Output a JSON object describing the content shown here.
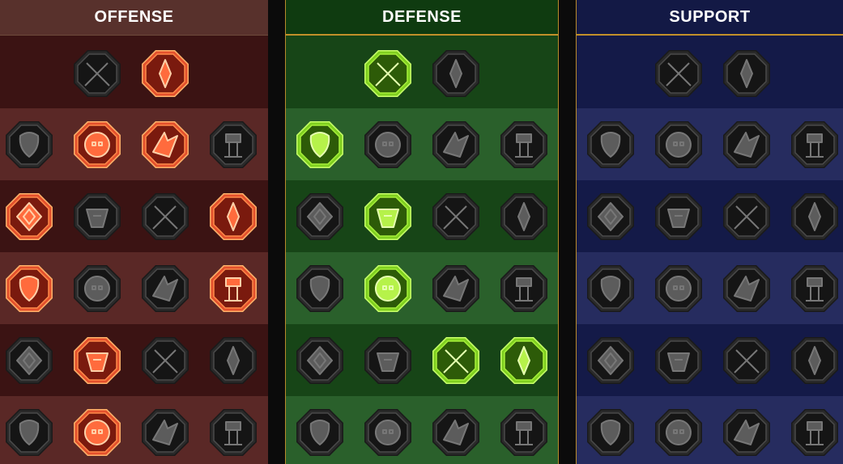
{
  "trees": [
    {
      "id": "offense",
      "title": "OFFENSE",
      "rows": [
        [
          {
            "icon": "crossed-swords-icon",
            "state": "inactive"
          },
          {
            "icon": "flaming-dagger-icon",
            "state": "active"
          }
        ],
        [
          {
            "icon": "horned-demon-icon",
            "state": "inactive"
          },
          {
            "icon": "slashing-blade-icon",
            "state": "active"
          },
          {
            "icon": "shield-breaker-icon",
            "state": "active"
          },
          {
            "icon": "thorned-heart-icon",
            "state": "inactive"
          }
        ],
        [
          {
            "icon": "pierced-warrior-icon",
            "state": "active"
          },
          {
            "icon": "fanged-maw-icon",
            "state": "inactive"
          },
          {
            "icon": "skull-slash-icon",
            "state": "inactive"
          },
          {
            "icon": "knife-strike-icon",
            "state": "active"
          }
        ],
        [
          {
            "icon": "bleeding-heart-icon",
            "state": "active"
          },
          {
            "icon": "iron-fist-icon",
            "state": "inactive"
          },
          {
            "icon": "battle-axe-icon",
            "state": "inactive"
          },
          {
            "icon": "lightning-chain-icon",
            "state": "active"
          }
        ],
        [
          {
            "icon": "impaled-target-icon",
            "state": "inactive"
          },
          {
            "icon": "triple-skull-icon",
            "state": "active"
          },
          {
            "icon": "dagger-aura-icon",
            "state": "inactive"
          },
          {
            "icon": "enraged-brute-icon",
            "state": "inactive"
          }
        ],
        [
          {
            "icon": "sword-sparkle-icon",
            "state": "inactive"
          },
          {
            "icon": "burning-helm-icon",
            "state": "active"
          },
          {
            "icon": "winged-beast-icon",
            "state": "inactive"
          },
          {
            "icon": "death-aura-icon",
            "state": "inactive"
          }
        ]
      ]
    },
    {
      "id": "defense",
      "title": "DEFENSE",
      "rows": [
        [
          {
            "icon": "armor-plates-icon",
            "state": "active"
          },
          {
            "icon": "raised-fist-icon",
            "state": "inactive"
          }
        ],
        [
          {
            "icon": "chevron-shield-icon",
            "state": "active"
          },
          {
            "icon": "stone-heart-icon",
            "state": "inactive"
          },
          {
            "icon": "armored-titan-icon",
            "state": "inactive"
          },
          {
            "icon": "deflect-blade-icon",
            "state": "inactive"
          }
        ],
        [
          {
            "icon": "evasive-figure-icon",
            "state": "inactive"
          },
          {
            "icon": "knight-shield-icon",
            "state": "active"
          },
          {
            "icon": "heart-icon",
            "state": "inactive"
          },
          {
            "icon": "protective-aura-icon",
            "state": "inactive"
          }
        ],
        [
          {
            "icon": "rallying-crowd-icon",
            "state": "inactive"
          },
          {
            "icon": "hourglass-icon",
            "state": "active"
          },
          {
            "icon": "open-palm-icon",
            "state": "inactive"
          },
          {
            "icon": "bull-head-icon",
            "state": "inactive"
          }
        ],
        [
          {
            "icon": "charging-runner-icon",
            "state": "inactive"
          },
          {
            "icon": "spiked-barrier-icon",
            "state": "inactive"
          },
          {
            "icon": "radiant-skull-icon",
            "state": "active"
          },
          {
            "icon": "grasping-hand-icon",
            "state": "active"
          }
        ],
        [
          {
            "icon": "fierce-warrior-icon",
            "state": "inactive"
          },
          {
            "icon": "winged-shield-icon",
            "state": "inactive"
          },
          {
            "icon": "shattered-skull-icon",
            "state": "inactive"
          },
          {
            "icon": "strongman-icon",
            "state": "inactive"
          }
        ]
      ]
    },
    {
      "id": "support",
      "title": "SUPPORT",
      "rows": [
        [
          {
            "icon": "healing-heart-icon",
            "state": "inactive"
          },
          {
            "icon": "swirling-crest-icon",
            "state": "inactive"
          }
        ],
        [
          {
            "icon": "praying-hands-icon",
            "state": "inactive"
          },
          {
            "icon": "shield-aura-icon",
            "state": "inactive"
          },
          {
            "icon": "flaming-skull-icon",
            "state": "inactive"
          },
          {
            "icon": "swift-hand-icon",
            "state": "inactive"
          }
        ],
        [
          {
            "icon": "empowered-figure-icon",
            "state": "inactive"
          },
          {
            "icon": "lightning-shield-icon",
            "state": "inactive"
          },
          {
            "icon": "cracked-ground-icon",
            "state": "inactive"
          },
          {
            "icon": "shadow-clone-icon",
            "state": "inactive"
          }
        ],
        [
          {
            "icon": "chained-heart-icon",
            "state": "inactive"
          },
          {
            "icon": "meteor-icon",
            "state": "inactive"
          },
          {
            "icon": "open-book-icon",
            "state": "inactive"
          },
          {
            "icon": "glaring-eyes-icon",
            "state": "inactive"
          }
        ],
        [
          {
            "icon": "compass-star-icon",
            "state": "inactive"
          },
          {
            "icon": "speed-boot-icon",
            "state": "inactive"
          },
          {
            "icon": "watchful-eye-icon",
            "state": "inactive"
          },
          {
            "icon": "crossed-bones-icon",
            "state": "inactive"
          }
        ],
        [
          {
            "icon": "potion-flask-icon",
            "state": "inactive"
          },
          {
            "icon": "horned-skull-icon",
            "state": "inactive"
          },
          {
            "icon": "clenched-gauntlet-icon",
            "state": "inactive"
          },
          {
            "icon": "eagle-head-icon",
            "state": "inactive"
          }
        ]
      ]
    }
  ],
  "colors": {
    "offense_active": "#e3502c",
    "defense_active": "#7fcf1f",
    "inactive_fill": "#151515",
    "inactive_ring": "#4a4a4a",
    "inactive_glyph": "#5c5c5c"
  }
}
